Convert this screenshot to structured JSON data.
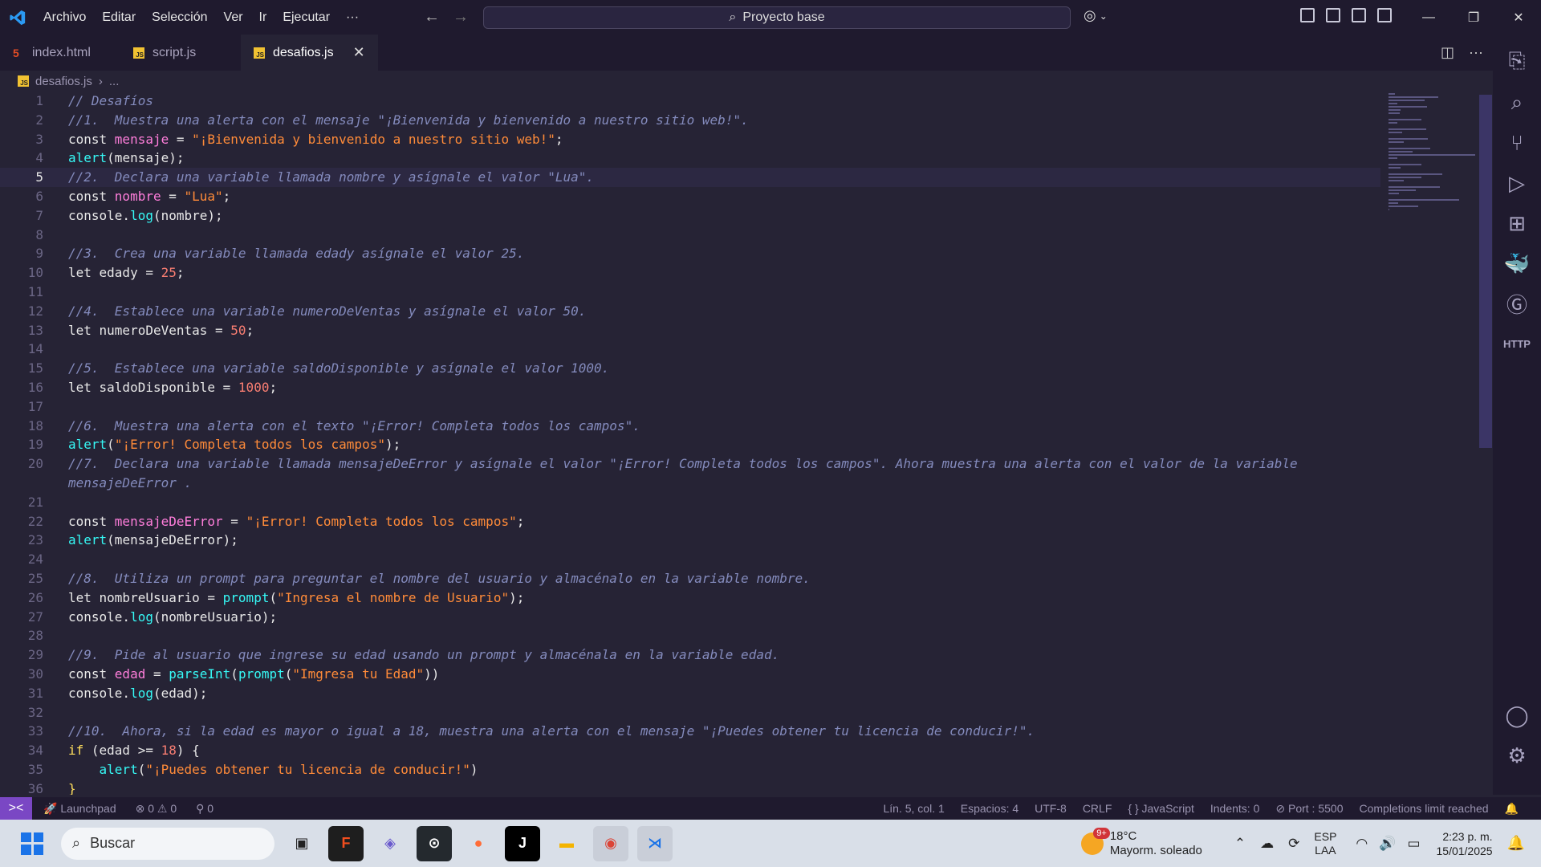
{
  "menu": [
    "Archivo",
    "Editar",
    "Selección",
    "Ver",
    "Ir",
    "Ejecutar",
    "···"
  ],
  "command_center": "Proyecto base",
  "tabs": [
    {
      "label": "index.html",
      "icon": "html-file-icon"
    },
    {
      "label": "script.js",
      "icon": "js-file-icon"
    },
    {
      "label": "desafios.js",
      "icon": "js-file-icon",
      "active": true
    }
  ],
  "breadcrumb": {
    "file": "desafios.js",
    "rest": "..."
  },
  "code_lines": [
    {
      "n": "1",
      "html": "<span class='c-com'>// Desafíos</span>"
    },
    {
      "n": "2",
      "html": "<span class='c-com'>//1.  Muestra una alerta con el mensaje \"¡Bienvenida y bienvenido a nuestro sitio web!\".</span>"
    },
    {
      "n": "3",
      "html": "<span class='c-txt'>const </span><span class='c-var'>mensaje</span><span class='c-txt'> = </span><span class='c-str'>\"¡Bienvenida y bienvenido a nuestro sitio web!\"</span><span class='c-txt'>;</span>"
    },
    {
      "n": "4",
      "html": "<span class='c-fn'>alert</span><span class='c-txt'>(mensaje);</span>"
    },
    {
      "n": "5",
      "html": "<span class='c-com'>//2.  Declara una variable llamada nombre y asígnale el valor \"Lua\".</span>",
      "current": true
    },
    {
      "n": "6",
      "html": "<span class='c-txt'>const </span><span class='c-var'>nombre</span><span class='c-txt'> = </span><span class='c-str'>\"Lua\"</span><span class='c-txt'>;</span>"
    },
    {
      "n": "7",
      "html": "<span class='c-txt'>console.</span><span class='c-fn'>log</span><span class='c-txt'>(nombre);</span>"
    },
    {
      "n": "8",
      "html": ""
    },
    {
      "n": "9",
      "html": "<span class='c-com'>//3.  Crea una variable llamada edady asígnale el valor 25.</span>"
    },
    {
      "n": "10",
      "html": "<span class='c-txt'>let edady = </span><span class='c-num'>25</span><span class='c-txt'>;</span>"
    },
    {
      "n": "11",
      "html": ""
    },
    {
      "n": "12",
      "html": "<span class='c-com'>//4.  Establece una variable numeroDeVentas y asígnale el valor 50.</span>"
    },
    {
      "n": "13",
      "html": "<span class='c-txt'>let numeroDeVentas = </span><span class='c-num'>50</span><span class='c-txt'>;</span>"
    },
    {
      "n": "14",
      "html": ""
    },
    {
      "n": "15",
      "html": "<span class='c-com'>//5.  Establece una variable saldoDisponible y asígnale el valor 1000.</span>"
    },
    {
      "n": "16",
      "html": "<span class='c-txt'>let saldoDisponible = </span><span class='c-num'>1000</span><span class='c-txt'>;</span>"
    },
    {
      "n": "17",
      "html": ""
    },
    {
      "n": "18",
      "html": "<span class='c-com'>//6.  Muestra una alerta con el texto \"¡Error! Completa todos los campos\".</span>"
    },
    {
      "n": "19",
      "html": "<span class='c-fn'>alert</span><span class='c-txt'>(</span><span class='c-str'>\"¡Error! Completa todos los campos\"</span><span class='c-txt'>);</span>"
    },
    {
      "n": "20",
      "html": "<span class='c-com'>//7.  Declara una variable llamada mensajeDeError y asígnale el valor \"¡Error! Completa todos los campos\". Ahora muestra una alerta con el valor de la variable</span>"
    },
    {
      "n": "",
      "html": "<span class='c-com'>mensajeDeError .</span>"
    },
    {
      "n": "21",
      "html": ""
    },
    {
      "n": "22",
      "html": "<span class='c-txt'>const </span><span class='c-var'>mensajeDeError</span><span class='c-txt'> = </span><span class='c-str'>\"¡Error! Completa todos los campos\"</span><span class='c-txt'>;</span>"
    },
    {
      "n": "23",
      "html": "<span class='c-fn'>alert</span><span class='c-txt'>(mensajeDeError);</span>"
    },
    {
      "n": "24",
      "html": ""
    },
    {
      "n": "25",
      "html": "<span class='c-com'>//8.  Utiliza un prompt para preguntar el nombre del usuario y almacénalo en la variable nombre.</span>"
    },
    {
      "n": "26",
      "html": "<span class='c-txt'>let nombreUsuario = </span><span class='c-fn'>prompt</span><span class='c-txt'>(</span><span class='c-str'>\"Ingresa el nombre de Usuario\"</span><span class='c-txt'>);</span>"
    },
    {
      "n": "27",
      "html": "<span class='c-txt'>console.</span><span class='c-fn'>log</span><span class='c-txt'>(nombreUsuario);</span>"
    },
    {
      "n": "28",
      "html": ""
    },
    {
      "n": "29",
      "html": "<span class='c-com'>//9.  Pide al usuario que ingrese su edad usando un prompt y almacénala en la variable edad.</span>"
    },
    {
      "n": "30",
      "html": "<span class='c-txt'>const </span><span class='c-var'>edad</span><span class='c-txt'> = </span><span class='c-fn'>parseInt</span><span class='c-txt'>(</span><span class='c-fn'>prompt</span><span class='c-txt'>(</span><span class='c-str'>\"Imgresa tu Edad\"</span><span class='c-txt'>))</span>"
    },
    {
      "n": "31",
      "html": "<span class='c-txt'>console.</span><span class='c-fn'>log</span><span class='c-txt'>(edad);</span>"
    },
    {
      "n": "32",
      "html": ""
    },
    {
      "n": "33",
      "html": "<span class='c-com'>//10.  Ahora, si la edad es mayor o igual a 18, muestra una alerta con el mensaje \"¡Puedes obtener tu licencia de conducir!\".</span>"
    },
    {
      "n": "34",
      "html": "<span class='c-kw'>if</span><span class='c-txt'> (edad >= </span><span class='c-num'>18</span><span class='c-txt'>) {</span>"
    },
    {
      "n": "35",
      "html": "<span class='c-txt'>    </span><span class='c-fn'>alert</span><span class='c-txt'>(</span><span class='c-str'>\"¡Puedes obtener tu licencia de conducir!\"</span><span class='c-txt'>)</span>"
    },
    {
      "n": "36",
      "html": "<span class='c-kw'>}</span>"
    }
  ],
  "status": {
    "remote": "><",
    "launchpad": "Launchpad",
    "problems": "⊗ 0 ⚠ 0",
    "ports": "⚲ 0",
    "position": "Lín. 5, col. 1",
    "spaces": "Espacios: 4",
    "encoding": "UTF-8",
    "eol": "CRLF",
    "language": "{ } JavaScript",
    "indents": "Indents: 0",
    "port": "⊘ Port : 5500",
    "completions": "Completions limit reached"
  },
  "taskbar": {
    "search_placeholder": "Buscar",
    "weather_temp": "18°C",
    "weather_desc": "Mayorm. soleado",
    "weather_badge": "9+",
    "lang_top": "ESP",
    "lang_bottom": "LAA",
    "time": "2:23 p. m.",
    "date": "15/01/2025"
  },
  "colors": {
    "accent": "#7a47c4",
    "comment": "#848bbd",
    "string": "#ff8b39",
    "function": "#36f9f6",
    "number": "#f97e72"
  }
}
